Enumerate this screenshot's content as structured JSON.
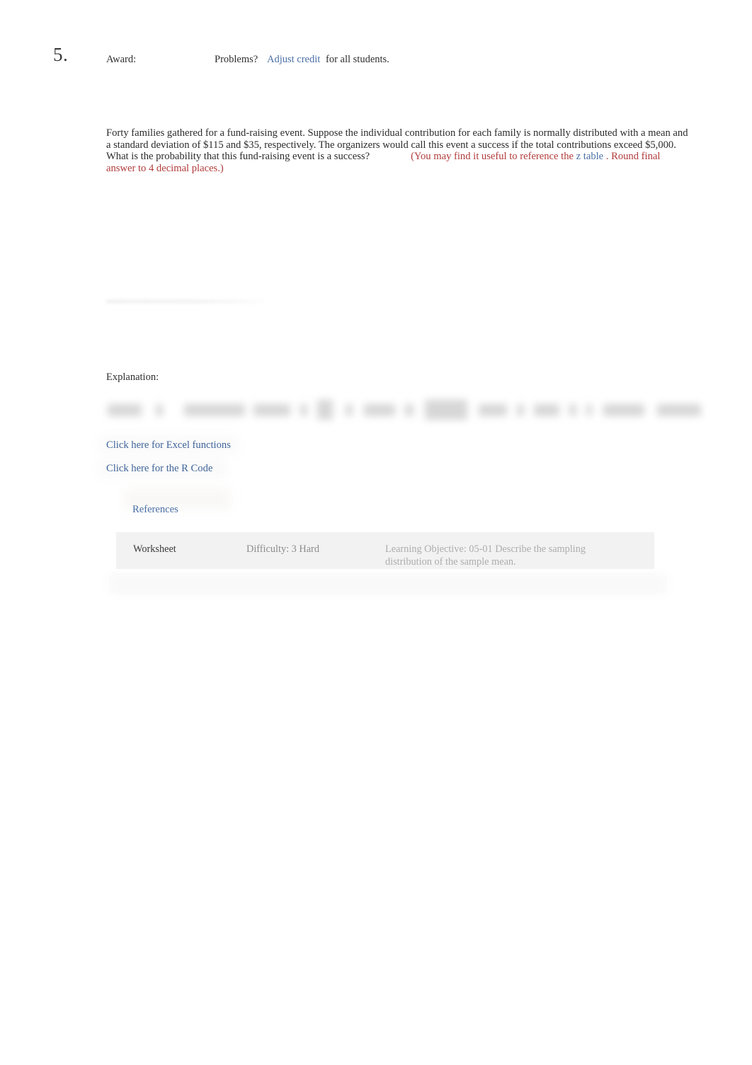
{
  "header": {
    "question_number": "5.",
    "award_label": "Award:",
    "award_value": "",
    "problems_label": "Problems?",
    "adjust_credit_link": "Adjust credit",
    "for_all_students": "for all students."
  },
  "question": {
    "body_part1": "Forty families gathered for a fund-raising event. Suppose the individual contribution for each family is normally distributed with a mean and a standard deviation of $115 and $35, respectively. The organizers would call this event a success if the total contributions exceed $5,000. What is the probability that this fund-raising event is a success?",
    "hint_prefix": "(You may find it useful to reference the",
    "hint_link": "z table",
    "hint_suffix": ". Round final answer to 4 decimal places.)"
  },
  "explanation": {
    "label": "Explanation:",
    "formula_redacted": ""
  },
  "links": {
    "excel_functions": "Click here for Excel functions",
    "r_code": "Click here for the R Code"
  },
  "references": {
    "title": "References",
    "row": {
      "type": "Worksheet",
      "difficulty": "Difficulty: 3 Hard",
      "learning_objective": "Learning Objective: 05-01 Describe the sampling distribution of the sample mean."
    }
  },
  "colors": {
    "link_blue": "#4a6fa5",
    "hint_red": "#b23b3b",
    "body_text": "#2b2b2b",
    "muted_text": "#8c8c8c",
    "faint_text": "#adadad",
    "row_background": "#f1f1f1"
  }
}
